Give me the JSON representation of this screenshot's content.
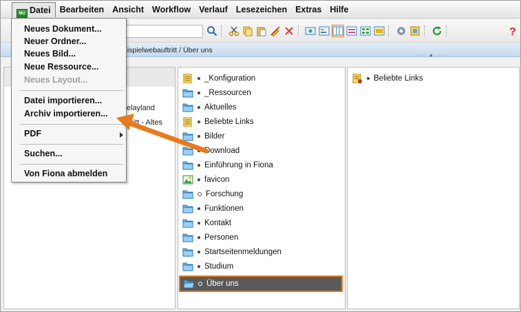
{
  "menubar": {
    "logo_text": "MU",
    "items": [
      "Datei",
      "Bearbeiten",
      "Ansicht",
      "Workflow",
      "Verlauf",
      "Lesezeichen",
      "Extras",
      "Hilfe"
    ]
  },
  "path": {
    "text": "eispielwebauftritt / Über uns"
  },
  "file_menu": {
    "items": [
      {
        "label": "Neues Dokument..."
      },
      {
        "label": "Neuer Ordner..."
      },
      {
        "label": "Neues Bild..."
      },
      {
        "label": "Neue Ressource..."
      },
      {
        "label": "Neues Layout..."
      },
      {
        "label": "Datei importieren..."
      },
      {
        "label": "Archiv importieren..."
      },
      {
        "label": "PDF"
      },
      {
        "label": "Suchen..."
      },
      {
        "label": "Von Fiona abmelden"
      }
    ]
  },
  "left_pane": {
    "partial_1": "elayland",
    "partial_2": "ftritt - Altes"
  },
  "folder_list": {
    "items": [
      {
        "label": "_Konfiguration",
        "icon": "document-icon"
      },
      {
        "label": "_Ressourcen",
        "icon": "folder-icon"
      },
      {
        "label": "Aktuelles",
        "icon": "folder-icon"
      },
      {
        "label": "Beliebte Links",
        "icon": "document-icon"
      },
      {
        "label": "Bilder",
        "icon": "folder-icon"
      },
      {
        "label": "Download",
        "icon": "folder-icon"
      },
      {
        "label": "Einführung in Fiona",
        "icon": "folder-icon"
      },
      {
        "label": "favicon",
        "icon": "image-icon"
      },
      {
        "label": "Forschung",
        "icon": "folder-icon"
      },
      {
        "label": "Funktionen",
        "icon": "folder-icon"
      },
      {
        "label": "Kontakt",
        "icon": "folder-icon"
      },
      {
        "label": "Personen",
        "icon": "folder-icon"
      },
      {
        "label": "Startseitenmeldungen",
        "icon": "folder-icon"
      },
      {
        "label": "Studium",
        "icon": "folder-icon"
      },
      {
        "label": "Über uns",
        "icon": "open-folder-icon"
      }
    ]
  },
  "right_pane": {
    "items": [
      {
        "label": "Beliebte Links",
        "icon": "document-link-icon"
      }
    ]
  },
  "colors": {
    "accent_orange": "#e87a1a",
    "selection_bg": "#5a5a5a",
    "path_bar": "#c4d9ee",
    "folder_blue": "#4a9bd8"
  }
}
